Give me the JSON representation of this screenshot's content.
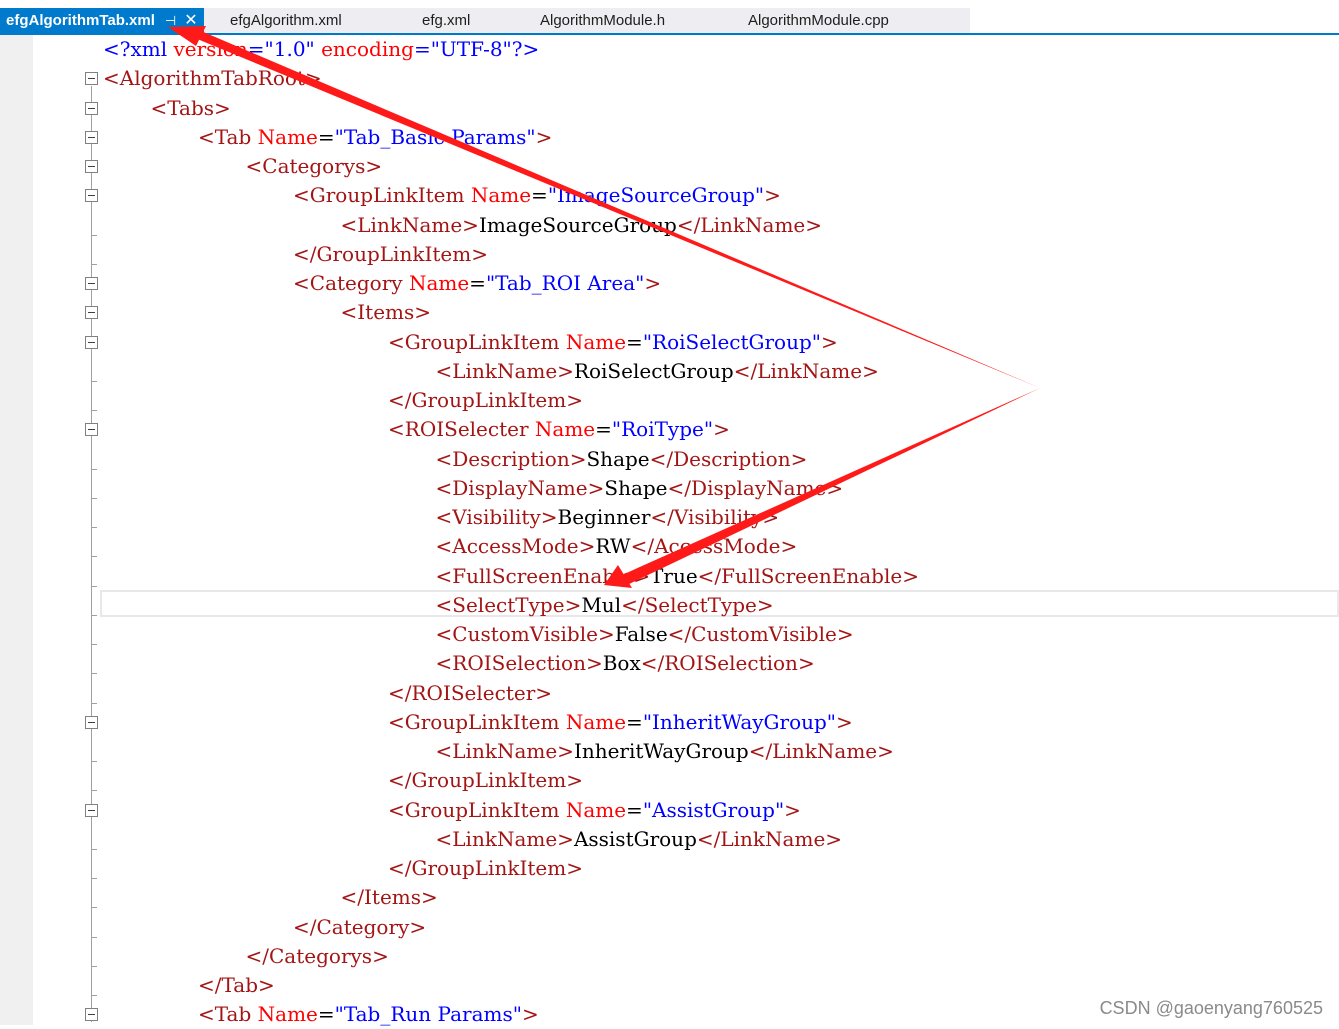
{
  "tabs": [
    {
      "label": "efgAlgorithmTab.xml",
      "active": true
    },
    {
      "label": "efgAlgorithm.xml",
      "active": false
    },
    {
      "label": "efg.xml",
      "active": false
    },
    {
      "label": "AlgorithmModule.h",
      "active": false
    },
    {
      "label": "AlgorithmModule.cpp",
      "active": false
    }
  ],
  "tab_pin_glyph": "⊣",
  "tab_close_glyph": "✕",
  "lines": [
    "<?xml version=\"1.0\" encoding=\"UTF-8\"?>",
    "<AlgorithmTabRoot>",
    "<Tabs>",
    "<Tab Name=\"Tab_Basic Params\">",
    "<Categorys>",
    "<GroupLinkItem Name=\"ImageSourceGroup\">",
    "<LinkName>ImageSourceGroup</LinkName>",
    "</GroupLinkItem>",
    "<Category Name=\"Tab_ROI Area\">",
    "<Items>",
    "<GroupLinkItem Name=\"RoiSelectGroup\">",
    "<LinkName>RoiSelectGroup</LinkName>",
    "</GroupLinkItem>",
    "<ROISelecter Name=\"RoiType\">",
    "<Description>Shape</Description>",
    "<DisplayName>Shape</DisplayName>",
    "<Visibility>Beginner</Visibility>",
    "<AccessMode>RW</AccessMode>",
    "<FullScreenEnable>True</FullScreenEnable>",
    "<SelectType>Mul</SelectType>",
    "<CustomVisible>False</CustomVisible>",
    "<ROISelection>Box</ROISelection>",
    "</ROISelecter>",
    "<GroupLinkItem Name=\"InheritWayGroup\">",
    "<LinkName>InheritWayGroup</LinkName>",
    "</GroupLinkItem>",
    "<GroupLinkItem Name=\"AssistGroup\">",
    "<LinkName>AssistGroup</LinkName>",
    "</GroupLinkItem>",
    "</Items>",
    "</Category>",
    "</Categorys>",
    "</Tab>",
    "<Tab Name=\"Tab_Run Params\">"
  ],
  "indent_levels": [
    0,
    0,
    1,
    2,
    3,
    4,
    5,
    4,
    4,
    5,
    6,
    7,
    6,
    6,
    7,
    7,
    7,
    7,
    7,
    7,
    7,
    7,
    6,
    6,
    7,
    6,
    6,
    7,
    6,
    5,
    4,
    3,
    2,
    2
  ],
  "foldable_lines": [
    1,
    2,
    3,
    4,
    5,
    8,
    9,
    10,
    13,
    23,
    26,
    33
  ],
  "current_line": 19,
  "colors": {
    "bracket": "#a31515",
    "tag_name": "#a31515",
    "attribute": "#ff0000",
    "attr_value": "#0000ff",
    "text": "#000000",
    "declaration": "#0000ff",
    "accent": "#007acc",
    "annotation_arrow": "#ff0000"
  },
  "watermark": "CSDN @gaoenyang760525"
}
